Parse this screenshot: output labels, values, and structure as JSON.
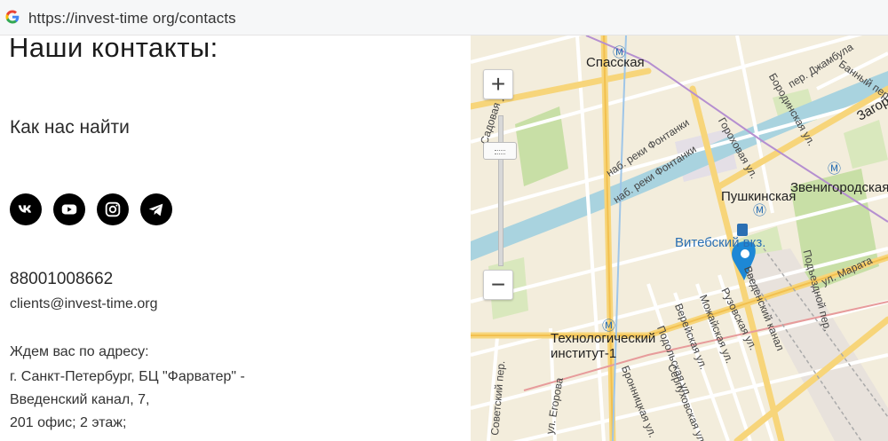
{
  "browser": {
    "url": "https://invest-time org/contacts"
  },
  "page": {
    "title": "Наши контакты:",
    "subtitle": "Как нас найти",
    "socials": [
      "vk-icon",
      "youtube-icon",
      "instagram-icon",
      "telegram-icon"
    ],
    "phone": "88001008662",
    "email": "clients@invest-time.org",
    "address_label": "Ждем вас по адресу:",
    "address_lines": [
      "г. Санкт-Петербург, БЦ \"Фарватер\" -",
      "Введенский канал, 7,",
      "201 офис; 2 этаж;"
    ]
  },
  "map": {
    "zoom_in": "+",
    "zoom_out": "−",
    "labels": {
      "spasskaya": "Спасская",
      "sadovaya": "Садовая ул.",
      "fontanka1": "наб. реки Фонтанки",
      "fontanka2": "наб. реки Фонтанки",
      "gorokhovaya": "Гороховая ул.",
      "dzhambula": "пер. Джамбула",
      "bannyy": "Банный пер.",
      "borodinskaya": "Бородинская ул.",
      "zagorodny": "Загородный",
      "zvenigorodskaya": "Звенигородская",
      "pushkinskaya": "Пушкинская",
      "vitebsky": "Витебский вкз.",
      "marata": "ул. Марата",
      "podezdnoy": "Подъездной пер.",
      "vvedensky": "Введенский канал",
      "ruzovskaya": "Рузовская ул.",
      "mozhayskaya": "Можайская ул.",
      "vereyskaya": "Верейская ул.",
      "podolskaya": "Подольская ул.",
      "serpukhovskaya": "Серпуховская ул.",
      "bronnitskaya": "Бронницкая ул.",
      "tekhnologichesky1": "Технологический",
      "tekhnologichesky2": "институт-1",
      "egorova": "ул. Егорова",
      "sovetsky": "Советский пер."
    }
  },
  "colors": {
    "map_bg": "#f3eddc",
    "water": "#a9d3df",
    "park": "#c8dfa6",
    "road_major": "#f7d57a",
    "metro": "#2a6fb3",
    "pin": "#1d88d6"
  }
}
